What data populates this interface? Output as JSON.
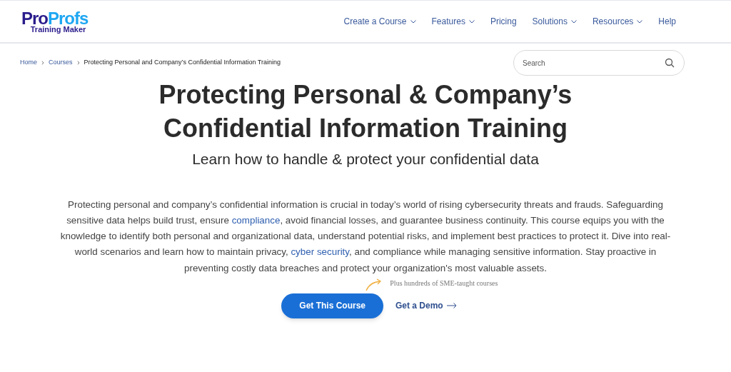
{
  "logo": {
    "brand_part1": "Pro",
    "brand_part2": "Profs",
    "product": "Training Maker"
  },
  "nav": [
    {
      "label": "Create a Course",
      "dropdown": true
    },
    {
      "label": "Features",
      "dropdown": true
    },
    {
      "label": "Pricing",
      "dropdown": false
    },
    {
      "label": "Solutions",
      "dropdown": true
    },
    {
      "label": "Resources",
      "dropdown": true
    },
    {
      "label": "Help",
      "dropdown": false
    }
  ],
  "breadcrumb": [
    {
      "label": "Home",
      "kind": "link"
    },
    {
      "label": "Courses",
      "kind": "link"
    },
    {
      "label": "Protecting Personal and Company’s Confidential Information Training",
      "kind": "current"
    }
  ],
  "search": {
    "placeholder": "Search"
  },
  "title": "Protecting Personal & Company’s Confidential Information Training",
  "subtitle": "Learn how to handle & protect your confidential data",
  "description": [
    {
      "kind": "text",
      "text": "Protecting personal and company’s confidential information is crucial in today’s world of rising cybersecurity threats and frauds. Safeguarding sensitive data helps build trust, ensure "
    },
    {
      "kind": "link",
      "text": "compliance"
    },
    {
      "kind": "text",
      "text": ", avoid financial losses, and guarantee business continuity. This course equips you with the knowledge to identify both personal and organizational data, understand potential risks, and implement best practices to protect it. Dive into real-world scenarios and learn how to maintain privacy, "
    },
    {
      "kind": "link",
      "text": "cyber security"
    },
    {
      "kind": "text",
      "text": ", and compliance while managing sensitive information. Stay proactive in preventing costly data breaches and protect your organization's most valuable assets."
    }
  ],
  "note": "Plus hundreds of SME-taught courses",
  "primary_button": "Get This Course",
  "secondary_link": "Get a Demo"
}
